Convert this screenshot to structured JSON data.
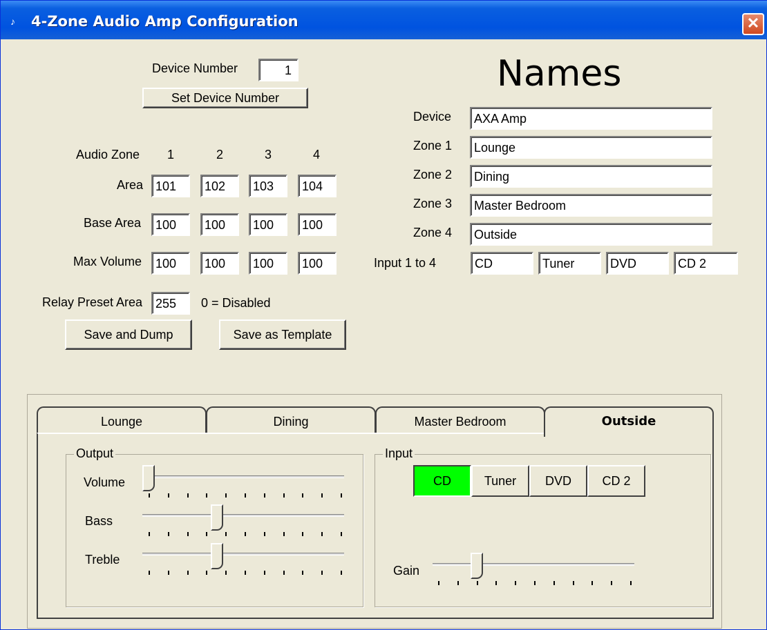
{
  "window": {
    "title": "4-Zone Audio Amp Configuration",
    "close_symbol": "✕",
    "icon": "speaker-app-icon"
  },
  "device": {
    "label": "Device Number",
    "value": "1",
    "set_button": "Set Device Number"
  },
  "zones": {
    "header_label": "Audio Zone",
    "columns": [
      "1",
      "2",
      "3",
      "4"
    ],
    "area_label": "Area",
    "area": [
      "101",
      "102",
      "103",
      "104"
    ],
    "base_area_label": "Base Area",
    "base_area": [
      "100",
      "100",
      "100",
      "100"
    ],
    "max_volume_label": "Max Volume",
    "max_volume": [
      "100",
      "100",
      "100",
      "100"
    ],
    "relay_label": "Relay Preset Area",
    "relay_value": "255",
    "relay_note": "0 = Disabled"
  },
  "actions": {
    "save_dump": "Save and Dump",
    "save_template": "Save as Template"
  },
  "names": {
    "title": "Names",
    "device_label": "Device",
    "device_value": "AXA Amp",
    "zone_labels": [
      "Zone 1",
      "Zone 2",
      "Zone 3",
      "Zone 4"
    ],
    "zone_values": [
      "Lounge",
      "Dining",
      "Master Bedroom",
      "Outside"
    ],
    "input_label": "Input 1 to 4",
    "inputs": [
      "CD",
      "Tuner",
      "DVD",
      "CD 2"
    ]
  },
  "tabs": {
    "items": [
      "Lounge",
      "Dining",
      "Master Bedroom",
      "Outside"
    ],
    "active": "Outside"
  },
  "output": {
    "title": "Output",
    "volume_label": "Volume",
    "bass_label": "Bass",
    "treble_label": "Treble",
    "volume_level": 0.0,
    "bass_level": 0.36,
    "treble_level": 0.36
  },
  "input_group": {
    "title": "Input",
    "buttons": [
      "CD",
      "Tuner",
      "DVD",
      "CD 2"
    ],
    "selected": "CD",
    "selected_color": "#00ff00",
    "gain_label": "Gain",
    "gain_level": 0.2
  }
}
